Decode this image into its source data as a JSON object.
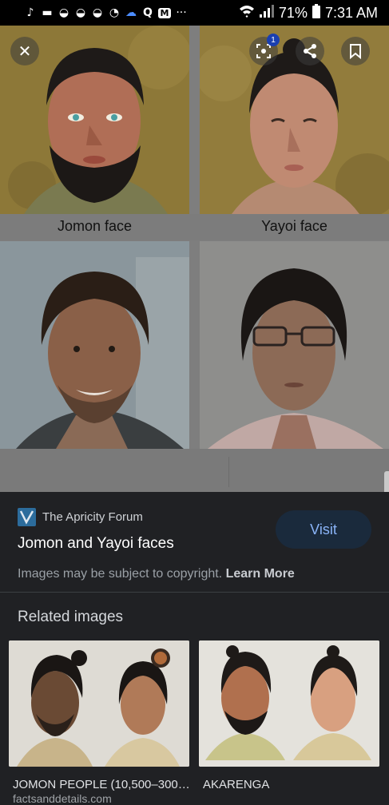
{
  "status_bar": {
    "icons": [
      "tiktok-icon",
      "payment-icon",
      "bowl-icon",
      "bowl-icon",
      "bowl-icon",
      "messenger-icon",
      "cloud-icon",
      "q-icon",
      "m-icon",
      "more-icon"
    ],
    "battery": "71%",
    "time": "7:31 AM"
  },
  "viewer": {
    "captions": {
      "left": "Jomon face",
      "right": "Yayoi face"
    },
    "lens_badge": "1"
  },
  "info": {
    "source_name": "The Apricity Forum",
    "title": "Jomon and Yayoi faces",
    "visit_label": "Visit",
    "copyright_text": "Images may be subject to copyright.",
    "learn_more": "Learn More"
  },
  "related": {
    "heading": "Related images",
    "items": [
      {
        "label": "JOMON PEOPLE (10,500–300…",
        "source": "factsanddetails.com"
      },
      {
        "label": "AKARENGA",
        "source": ""
      }
    ]
  }
}
